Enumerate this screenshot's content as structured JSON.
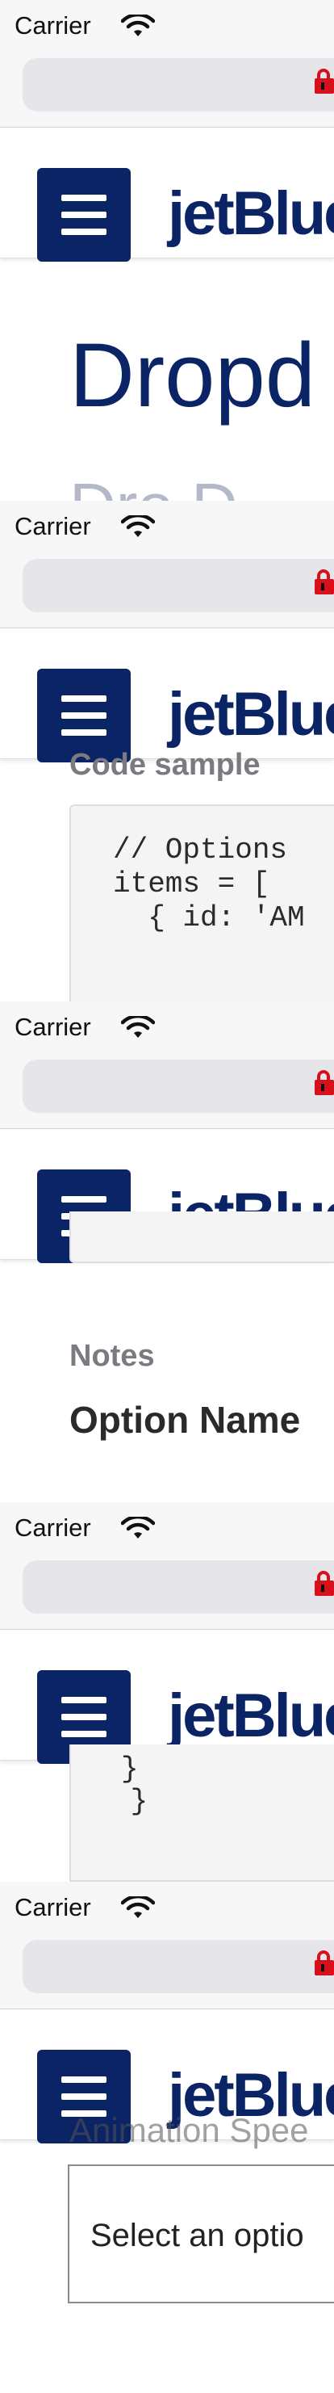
{
  "status": {
    "carrier": "Carrier",
    "wifi_icon": "wifi-icon"
  },
  "browser": {
    "lock_icon": "lock-icon",
    "lock_color": "#d8101c"
  },
  "header": {
    "logo_text": "jetBlue",
    "menu_icon": "hamburger-menu-icon",
    "brand_color": "#0b2465"
  },
  "page": {
    "title": "Dropd",
    "title_peek": "Dro D"
  },
  "code_section": {
    "label": "Code sample",
    "lines": [
      "// Options",
      "items = [",
      "  { id: 'AM"
    ]
  },
  "notes_section": {
    "label": "Notes",
    "heading": "Option Name"
  },
  "code_tail": {
    "lines": [
      "}",
      " }"
    ]
  },
  "select_section": {
    "label_peek": "Animation Spee",
    "select_text": "Select an optio"
  }
}
